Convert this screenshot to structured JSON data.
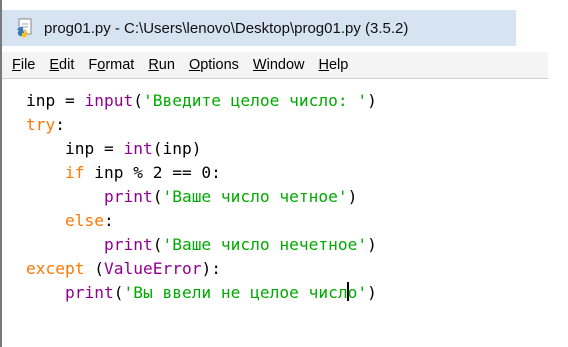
{
  "window": {
    "title": "prog01.py - C:\\Users\\lenovo\\Desktop\\prog01.py (3.5.2)",
    "icon": "python-file-icon"
  },
  "menu": {
    "items": [
      {
        "label": "File",
        "accel": "F",
        "rest": "ile"
      },
      {
        "label": "Edit",
        "accel": "E",
        "rest": "dit"
      },
      {
        "label": "Format",
        "accel": "o",
        "pre": "F",
        "rest": "rmat"
      },
      {
        "label": "Run",
        "accel": "R",
        "rest": "un"
      },
      {
        "label": "Options",
        "accel": "O",
        "rest": "ptions"
      },
      {
        "label": "Window",
        "accel": "W",
        "rest": "indow"
      },
      {
        "label": "Help",
        "accel": "H",
        "rest": "elp"
      }
    ]
  },
  "editor": {
    "lines": [
      [
        {
          "t": "plain",
          "v": "inp = "
        },
        {
          "t": "bi",
          "v": "input"
        },
        {
          "t": "plain",
          "v": "("
        },
        {
          "t": "str",
          "v": "'Введите целое число: '"
        },
        {
          "t": "plain",
          "v": ")"
        }
      ],
      [
        {
          "t": "kw",
          "v": "try"
        },
        {
          "t": "plain",
          "v": ":"
        }
      ],
      [
        {
          "t": "plain",
          "v": "    inp = "
        },
        {
          "t": "bi",
          "v": "int"
        },
        {
          "t": "plain",
          "v": "(inp)"
        }
      ],
      [
        {
          "t": "plain",
          "v": "    "
        },
        {
          "t": "kw",
          "v": "if"
        },
        {
          "t": "plain",
          "v": " inp % 2 == 0:"
        }
      ],
      [
        {
          "t": "plain",
          "v": "        "
        },
        {
          "t": "bi",
          "v": "print"
        },
        {
          "t": "plain",
          "v": "("
        },
        {
          "t": "str",
          "v": "'Ваше число четное'"
        },
        {
          "t": "plain",
          "v": ")"
        }
      ],
      [
        {
          "t": "plain",
          "v": "    "
        },
        {
          "t": "kw",
          "v": "else"
        },
        {
          "t": "plain",
          "v": ":"
        }
      ],
      [
        {
          "t": "plain",
          "v": "        "
        },
        {
          "t": "bi",
          "v": "print"
        },
        {
          "t": "plain",
          "v": "("
        },
        {
          "t": "str",
          "v": "'Ваше число нечетное'"
        },
        {
          "t": "plain",
          "v": ")"
        }
      ],
      [
        {
          "t": "kw",
          "v": "except"
        },
        {
          "t": "plain",
          "v": " ("
        },
        {
          "t": "bi",
          "v": "ValueError"
        },
        {
          "t": "plain",
          "v": "):"
        }
      ],
      [
        {
          "t": "plain",
          "v": "    "
        },
        {
          "t": "bi",
          "v": "print"
        },
        {
          "t": "plain",
          "v": "("
        },
        {
          "t": "str",
          "v": "'Вы ввели не целое числ"
        },
        {
          "t": "caret",
          "v": ""
        },
        {
          "t": "str",
          "v": "о'"
        },
        {
          "t": "plain",
          "v": ")"
        }
      ]
    ]
  },
  "colors": {
    "keyword": "#ff7700",
    "builtin": "#900090",
    "string": "#00aa00",
    "titlebar": "#d6e3f1"
  }
}
